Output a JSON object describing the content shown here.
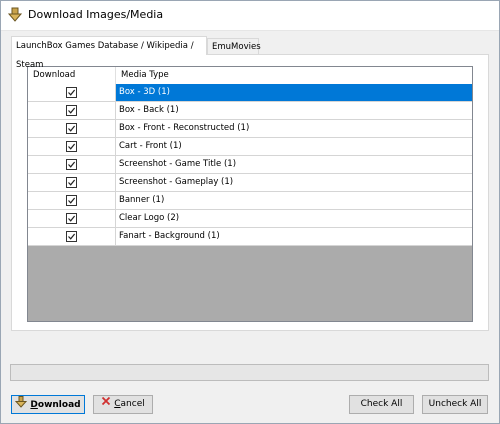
{
  "window": {
    "title": "Download Images/Media",
    "icon": "download-arrow-icon"
  },
  "tabs": [
    {
      "label": "LaunchBox Games Database / Wikipedia / Steam",
      "active": true
    },
    {
      "label": "EmuMovies",
      "active": false
    }
  ],
  "grid": {
    "columns": [
      "Download",
      "Media Type"
    ],
    "rows": [
      {
        "checked": true,
        "name": "Box - 3D (1)",
        "selected": true
      },
      {
        "checked": true,
        "name": "Box - Back (1)",
        "selected": false
      },
      {
        "checked": true,
        "name": "Box - Front - Reconstructed (1)",
        "selected": false
      },
      {
        "checked": true,
        "name": "Cart - Front (1)",
        "selected": false
      },
      {
        "checked": true,
        "name": "Screenshot - Game Title (1)",
        "selected": false
      },
      {
        "checked": true,
        "name": "Screenshot - Gameplay (1)",
        "selected": false
      },
      {
        "checked": true,
        "name": "Banner (1)",
        "selected": false
      },
      {
        "checked": true,
        "name": "Clear Logo (2)",
        "selected": false
      },
      {
        "checked": true,
        "name": "Fanart - Background (1)",
        "selected": false
      }
    ]
  },
  "buttons": {
    "download_first": "D",
    "download_rest": "ownload",
    "cancel_first": "C",
    "cancel_rest": "ancel",
    "check_all": "Check All",
    "uncheck_all": "Uncheck All"
  },
  "colors": {
    "selection": "#0078d7",
    "grid_empty": "#ababab",
    "accent_border": "#0078d7"
  }
}
